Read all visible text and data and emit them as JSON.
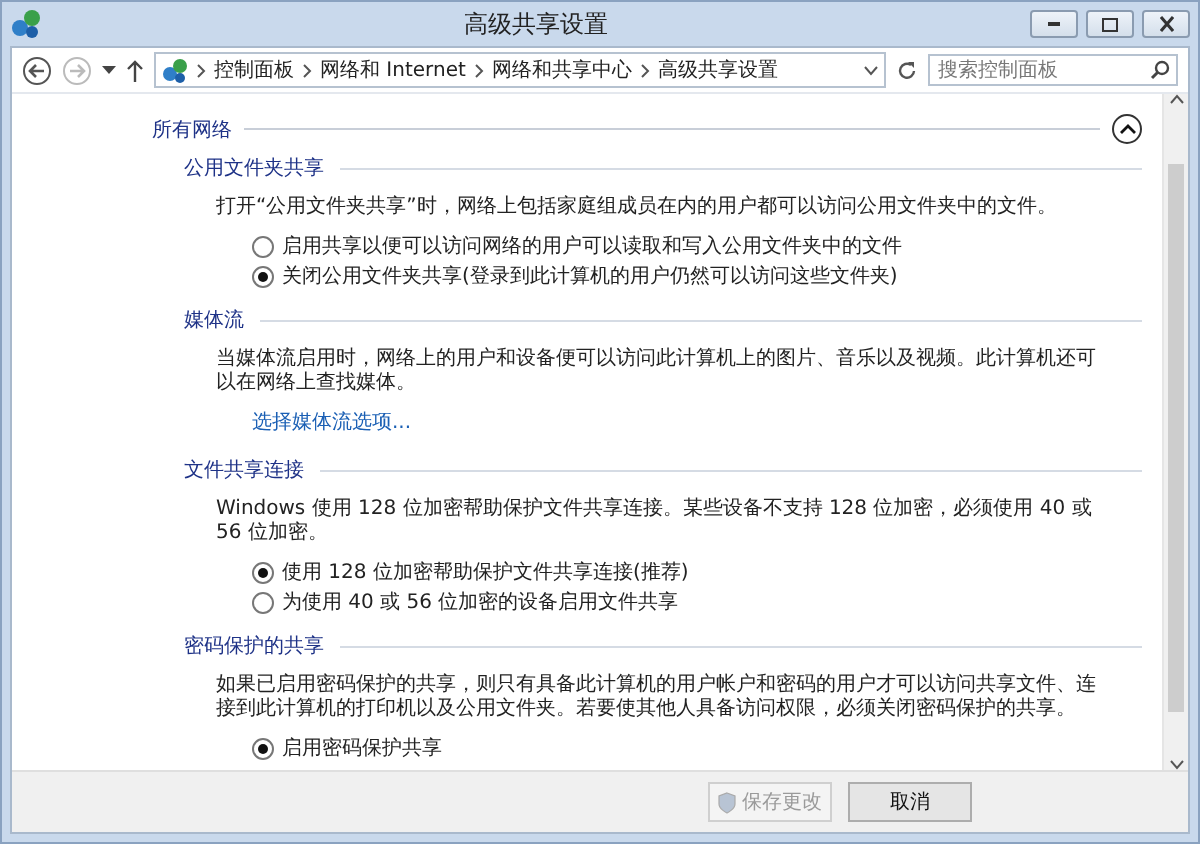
{
  "window": {
    "title": "高级共享设置"
  },
  "breadcrumb": [
    "控制面板",
    "网络和 Internet",
    "网络和共享中心",
    "高级共享设置"
  ],
  "search": {
    "placeholder": "搜索控制面板"
  },
  "group": {
    "title": "所有网络",
    "expanded": true
  },
  "sections": [
    {
      "title": "公用文件夹共享",
      "description": "打开“公用文件夹共享”时，网络上包括家庭组成员在内的用户都可以访问公用文件夹中的文件。",
      "options": [
        {
          "label": "启用共享以便可以访问网络的用户可以读取和写入公用文件夹中的文件",
          "selected": false
        },
        {
          "label": "关闭公用文件夹共享(登录到此计算机的用户仍然可以访问这些文件夹)",
          "selected": true
        }
      ]
    },
    {
      "title": "媒体流",
      "description": "当媒体流启用时，网络上的用户和设备便可以访问此计算机上的图片、音乐以及视频。此计算机还可以在网络上查找媒体。",
      "link": "选择媒体流选项..."
    },
    {
      "title": "文件共享连接",
      "description": "Windows 使用 128 位加密帮助保护文件共享连接。某些设备不支持 128 位加密，必须使用 40 或 56 位加密。",
      "options": [
        {
          "label": "使用 128 位加密帮助保护文件共享连接(推荐)",
          "selected": true
        },
        {
          "label": "为使用 40 或 56 位加密的设备启用文件共享",
          "selected": false
        }
      ]
    },
    {
      "title": "密码保护的共享",
      "description": "如果已启用密码保护的共享，则只有具备此计算机的用户帐户和密码的用户才可以访问共享文件、连接到此计算机的打印机以及公用文件夹。若要使其他人具备访问权限，必须关闭密码保护的共享。",
      "options": [
        {
          "label": "启用密码保护共享",
          "selected": true
        }
      ]
    }
  ],
  "buttons": [
    {
      "label": "保存更改",
      "kind": "shield",
      "disabled": true
    },
    {
      "label": "取消",
      "kind": "plain",
      "disabled": false
    }
  ]
}
